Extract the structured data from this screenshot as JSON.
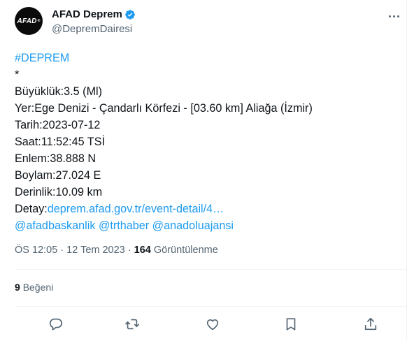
{
  "account": {
    "name": "AFAD Deprem",
    "handle": "@DepremDairesi",
    "avatar_text": "AFAD"
  },
  "tweet": {
    "hashtag": "#DEPREM",
    "star": "*",
    "magnitude": "Büyüklük:3.5 (Ml)",
    "location": "Yer:Ege Denizi - Çandarlı Körfezi - [03.60 km] Aliağa (İzmir)",
    "date": "Tarih:2023-07-12",
    "time": "Saat:11:52:45 TSİ",
    "latitude": "Enlem:38.888 N",
    "longitude": "Boylam:27.024 E",
    "depth": "Derinlik:10.09 km",
    "detail_label": "Detay:",
    "detail_link": "deprem.afad.gov.tr/event-detail/4…",
    "mentions": [
      "@afadbaskanlik",
      "@trthaber",
      "@anadoluajansi"
    ]
  },
  "meta": {
    "time": "ÖS 12:05",
    "separator": "·",
    "date": "12 Tem 2023",
    "views_count": "164",
    "views_label": "Görüntülenme"
  },
  "engagement": {
    "likes_count": "9",
    "likes_label": "Beğeni"
  },
  "actions": [
    "reply-icon",
    "retweet-icon",
    "like-icon",
    "bookmark-icon",
    "share-icon"
  ],
  "colors": {
    "link": "#1d9bf0",
    "verified": "#1d9bf0",
    "muted": "#536471"
  }
}
